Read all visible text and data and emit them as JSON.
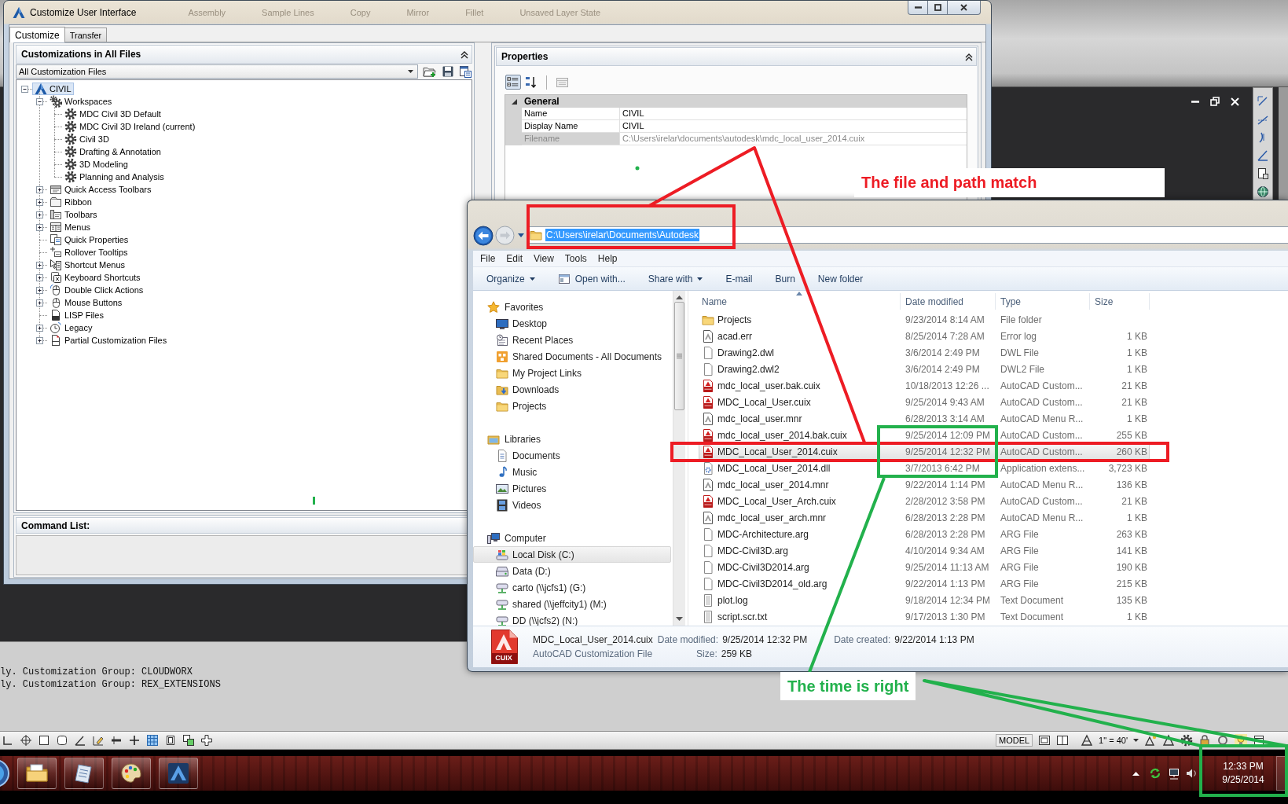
{
  "autocad": {
    "ribbon_labels": [
      "Assembly",
      "Sample Lines",
      "Copy",
      "Mirror",
      "Fillet",
      "Unsaved Layer State"
    ],
    "command_history": [
      "ly. Customization Group: CLOUDWORX",
      "ly. Customization Group: REX_EXTENSIONS"
    ],
    "status_bar": {
      "space": "MODEL",
      "annotation_scale": "1\" = 40'"
    }
  },
  "cui_dialog": {
    "title": "Customize User Interface",
    "tabs": [
      {
        "label": "Customize",
        "selected": true
      },
      {
        "label": "Transfer",
        "selected": false
      }
    ],
    "customizations": {
      "title": "Customizations in All Files",
      "file_filter": "All Customization Files",
      "tree": [
        {
          "label": "CIVIL",
          "expanded": true,
          "selected": true,
          "children": [
            {
              "label": "Workspaces",
              "expanded": true,
              "selected": false,
              "children": [
                {
                  "label": "MDC Civil 3D Default",
                  "selected": false
                },
                {
                  "label": "MDC Civil 3D Ireland (current)",
                  "selected": false
                },
                {
                  "label": "Civil 3D",
                  "selected": false
                },
                {
                  "label": "Drafting & Annotation",
                  "selected": false
                },
                {
                  "label": "3D Modeling",
                  "selected": false
                },
                {
                  "label": "Planning and Analysis",
                  "selected": false
                }
              ]
            },
            {
              "label": "Quick Access Toolbars",
              "expanded": false,
              "selected": false
            },
            {
              "label": "Ribbon",
              "expanded": false,
              "selected": false
            },
            {
              "label": "Toolbars",
              "expanded": false,
              "selected": false
            },
            {
              "label": "Menus",
              "expanded": false,
              "selected": false
            },
            {
              "label": "Quick Properties",
              "selected": false
            },
            {
              "label": "Rollover Tooltips",
              "selected": false
            },
            {
              "label": "Shortcut Menus",
              "expanded": false,
              "selected": false
            },
            {
              "label": "Keyboard Shortcuts",
              "expanded": false,
              "selected": false
            },
            {
              "label": "Double Click Actions",
              "expanded": false,
              "selected": false
            },
            {
              "label": "Mouse Buttons",
              "expanded": false,
              "selected": false
            },
            {
              "label": "LISP Files",
              "selected": false
            },
            {
              "label": "Legacy",
              "expanded": false,
              "selected": false
            },
            {
              "label": "Partial Customization Files",
              "expanded": false,
              "selected": false
            }
          ]
        }
      ]
    },
    "command_list": {
      "title": "Command List:"
    },
    "properties": {
      "title": "Properties",
      "category": {
        "label": "General",
        "expanded": true
      },
      "rows": [
        {
          "name": "Name",
          "value": "CIVIL",
          "disabled": false
        },
        {
          "name": "Display Name",
          "value": "CIVIL",
          "disabled": false
        },
        {
          "name": "Filename",
          "value": "C:\\Users\\irelar\\documents\\autodesk\\mdc_local_user_2014.cuix",
          "disabled": true
        }
      ]
    }
  },
  "explorer": {
    "address": "C:\\Users\\irelar\\Documents\\Autodesk",
    "address_selected": true,
    "menu": [
      "File",
      "Edit",
      "View",
      "Tools",
      "Help"
    ],
    "toolbar": [
      {
        "label": "Organize",
        "kind": "menu"
      },
      {
        "label": "Open with...",
        "kind": "icon"
      },
      {
        "label": "Share with",
        "kind": "menu"
      },
      {
        "label": "E-mail",
        "kind": "plain"
      },
      {
        "label": "Burn",
        "kind": "plain"
      },
      {
        "label": "New folder",
        "kind": "plain"
      }
    ],
    "navigation": [
      {
        "label": "Favorites",
        "selected": false,
        "children": [
          {
            "label": "Desktop",
            "selected": false
          },
          {
            "label": "Recent Places",
            "selected": false
          },
          {
            "label": "Shared Documents - All Documents",
            "selected": false
          },
          {
            "label": "My Project Links",
            "selected": false
          },
          {
            "label": "Downloads",
            "selected": false
          },
          {
            "label": "Projects",
            "selected": false
          }
        ]
      },
      {
        "label": "Libraries",
        "selected": false,
        "children": [
          {
            "label": "Documents",
            "selected": false
          },
          {
            "label": "Music",
            "selected": false
          },
          {
            "label": "Pictures",
            "selected": false
          },
          {
            "label": "Videos",
            "selected": false
          }
        ]
      },
      {
        "label": "Computer",
        "selected": false,
        "children": [
          {
            "label": "Local Disk (C:)",
            "selected": true
          },
          {
            "label": "Data (D:)",
            "selected": false
          },
          {
            "label": "carto (\\\\jcfs1) (G:)",
            "selected": false
          },
          {
            "label": "shared (\\\\jeffcity1) (M:)",
            "selected": false
          },
          {
            "label": "DD (\\\\jcfs2) (N:)",
            "selected": false
          }
        ]
      }
    ],
    "columns": [
      {
        "label": "Name",
        "sorted": true
      },
      {
        "label": "Date modified",
        "sorted": false
      },
      {
        "label": "Type",
        "sorted": false
      },
      {
        "label": "Size",
        "sorted": false
      }
    ],
    "files": [
      {
        "name": "Projects",
        "date": "9/23/2014 8:14 AM",
        "type": "File folder",
        "selected": false
      },
      {
        "name": "acad.err",
        "date": "8/25/2014 7:28 AM",
        "type": "Error log",
        "size": "1 KB",
        "selected": false
      },
      {
        "name": "Drawing2.dwl",
        "date": "3/6/2014 2:49 PM",
        "type": "DWL File",
        "size": "1 KB",
        "selected": false
      },
      {
        "name": "Drawing2.dwl2",
        "date": "3/6/2014 2:49 PM",
        "type": "DWL2 File",
        "size": "1 KB",
        "selected": false
      },
      {
        "name": "mdc_local_user.bak.cuix",
        "date": "10/18/2013 12:26 ...",
        "type": "AutoCAD Custom...",
        "size": "21 KB",
        "selected": false
      },
      {
        "name": "MDC_Local_User.cuix",
        "date": "9/25/2014 9:43 AM",
        "type": "AutoCAD Custom...",
        "size": "21 KB",
        "selected": false
      },
      {
        "name": "mdc_local_user.mnr",
        "date": "6/28/2013 3:14 AM",
        "type": "AutoCAD Menu R...",
        "size": "1 KB",
        "selected": false
      },
      {
        "name": "mdc_local_user_2014.bak.cuix",
        "date": "9/25/2014 12:09 PM",
        "type": "AutoCAD Custom...",
        "size": "255 KB",
        "selected": false
      },
      {
        "name": "MDC_Local_User_2014.cuix",
        "date": "9/25/2014 12:32 PM",
        "type": "AutoCAD Custom...",
        "size": "260 KB",
        "selected": true
      },
      {
        "name": "MDC_Local_User_2014.dll",
        "date": "3/7/2013 6:42 PM",
        "type": "Application extens...",
        "size": "3,723 KB",
        "selected": false
      },
      {
        "name": "mdc_local_user_2014.mnr",
        "date": "9/22/2014 1:14 PM",
        "type": "AutoCAD Menu R...",
        "size": "136 KB",
        "selected": false
      },
      {
        "name": "MDC_Local_User_Arch.cuix",
        "date": "2/28/2012 3:58 PM",
        "type": "AutoCAD Custom...",
        "size": "21 KB",
        "selected": false
      },
      {
        "name": "mdc_local_user_arch.mnr",
        "date": "6/28/2013 2:28 PM",
        "type": "AutoCAD Menu R...",
        "size": "1 KB",
        "selected": false
      },
      {
        "name": "MDC-Architecture.arg",
        "date": "6/28/2013 2:28 PM",
        "type": "ARG File",
        "size": "263 KB",
        "selected": false
      },
      {
        "name": "MDC-Civil3D.arg",
        "date": "4/10/2014 9:34 AM",
        "type": "ARG File",
        "size": "141 KB",
        "selected": false
      },
      {
        "name": "MDC-Civil3D2014.arg",
        "date": "9/25/2014 11:13 AM",
        "type": "ARG File",
        "size": "190 KB",
        "selected": false
      },
      {
        "name": "MDC-Civil3D2014_old.arg",
        "date": "9/22/2014 1:13 PM",
        "type": "ARG File",
        "size": "215 KB",
        "selected": false
      },
      {
        "name": "plot.log",
        "date": "9/18/2014 12:34 PM",
        "type": "Text Document",
        "size": "135 KB",
        "selected": false
      },
      {
        "name": "script.scr.txt",
        "date": "9/17/2013 1:30 PM",
        "type": "Text Document",
        "size": "1 KB",
        "selected": false
      }
    ],
    "details": {
      "icon_label": "CUIX",
      "name": "MDC_Local_User_2014.cuix",
      "type": "AutoCAD Customization File",
      "fields": [
        {
          "label": "Date modified:",
          "value": "9/25/2014 12:32 PM"
        },
        {
          "label": "Size:",
          "value": "259 KB"
        },
        {
          "label": "Date created:",
          "value": "9/22/2014 1:13 PM"
        }
      ]
    }
  },
  "taskbar": {
    "time": "12:33 PM",
    "date": "9/25/2014"
  },
  "annotations": [
    {
      "text": "The file and path match",
      "color": "#ed1c24"
    },
    {
      "text": "The time is right",
      "color": "#22b14c"
    }
  ]
}
